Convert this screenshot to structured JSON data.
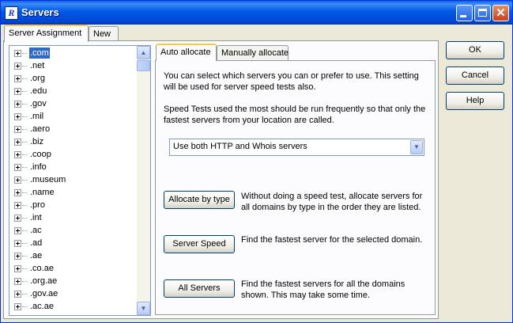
{
  "window": {
    "title": "Servers",
    "icon": "R"
  },
  "outer_tabs": [
    "Server Assignment",
    "New"
  ],
  "inner_tabs": [
    "Auto allocate",
    "Manually allocate"
  ],
  "domains": [
    ".com",
    ".net",
    ".org",
    ".edu",
    ".gov",
    ".mil",
    ".aero",
    ".biz",
    ".coop",
    ".info",
    ".museum",
    ".name",
    ".pro",
    ".int",
    ".ac",
    ".ad",
    ".ae",
    ".co.ae",
    ".org.ae",
    ".gov.ae",
    ".ac.ae"
  ],
  "selected_domain": ".com",
  "auto": {
    "intro": "You can select which servers you can or prefer to use. This setting will be used for server speed tests also.",
    "speed_note": "Speed Tests used the most should be run frequently so that only the fastest servers from your location are called.",
    "server_mode": "Use both HTTP and Whois servers",
    "allocate_by_type_label": "Allocate by type",
    "allocate_by_type_desc": "Without doing a speed test, allocate servers for all domains by type in the order they are listed.",
    "server_speed_label": "Server Speed",
    "server_speed_desc": "Find the fastest server for the selected domain.",
    "all_servers_label": "All Servers",
    "all_servers_desc": "Find the fastest servers for all the domains shown.  This may take some time."
  },
  "buttons": {
    "ok": "OK",
    "cancel": "Cancel",
    "help": "Help"
  }
}
